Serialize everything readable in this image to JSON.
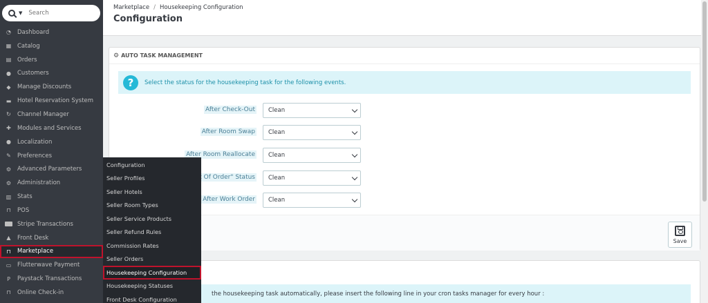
{
  "search": {
    "placeholder": "Search"
  },
  "sidebar": {
    "items": [
      {
        "label": "Dashboard",
        "icon": "dashboard-icon"
      },
      {
        "label": "Catalog",
        "icon": "catalog-icon"
      },
      {
        "label": "Orders",
        "icon": "orders-icon"
      },
      {
        "label": "Customers",
        "icon": "customers-icon"
      },
      {
        "label": "Manage Discounts",
        "icon": "tag-icon"
      },
      {
        "label": "Hotel Reservation System",
        "icon": "bed-icon"
      },
      {
        "label": "Channel Manager",
        "icon": "refresh-icon"
      },
      {
        "label": "Modules and Services",
        "icon": "puzzle-icon"
      },
      {
        "label": "Localization",
        "icon": "globe-icon"
      },
      {
        "label": "Preferences",
        "icon": "wrench-icon"
      },
      {
        "label": "Advanced Parameters",
        "icon": "cogs-icon"
      },
      {
        "label": "Administration",
        "icon": "gear-icon"
      },
      {
        "label": "Stats",
        "icon": "bar-chart-icon"
      },
      {
        "label": "POS",
        "icon": "cart-icon"
      },
      {
        "label": "Stripe Transactions",
        "icon": "stripe-icon"
      },
      {
        "label": "Front Desk",
        "icon": "bell-icon"
      },
      {
        "label": "Marketplace",
        "icon": "cart-icon"
      },
      {
        "label": "Flutterwave Payment",
        "icon": "money-icon"
      },
      {
        "label": "Paystack Transactions",
        "icon": "paystack-icon"
      },
      {
        "label": "Online Check-in",
        "icon": "cart-icon"
      }
    ],
    "active_index": 16
  },
  "flyout": {
    "items": [
      "Configuration",
      "Seller Profiles",
      "Seller Hotels",
      "Seller Room Types",
      "Seller Service Products",
      "Seller Refund Rules",
      "Commission Rates",
      "Seller Orders",
      "Housekeeping Configuration",
      "Housekeeping Statuses",
      "Front Desk Configuration"
    ],
    "active_index": 8
  },
  "header": {
    "breadcrumb_parent": "Marketplace",
    "breadcrumb_separator": "/",
    "breadcrumb_current": "Housekeeping Configuration",
    "title": "Configuration"
  },
  "panel": {
    "heading": "AUTO TASK MANAGEMENT",
    "info": "Select the status for the housekeeping task for the following events.",
    "fields": [
      {
        "label": "After Check-Out",
        "value": "Clean"
      },
      {
        "label": "After Room Swap",
        "value": "Clean"
      },
      {
        "label": "After Room Reallocate",
        "value": "Clean"
      },
      {
        "label": "t Of Order\" Status",
        "value": "Clean"
      },
      {
        "label": "After Work Order",
        "value": "Clean"
      }
    ],
    "save_label": "Save"
  },
  "panel2": {
    "cron_text": "the housekeeping task automatically, please insert the following line in your cron tasks manager for every hour :"
  },
  "colors": {
    "accent": "#25b9d7",
    "active_border": "#c0132c",
    "sidebar_bg": "#363a41"
  }
}
